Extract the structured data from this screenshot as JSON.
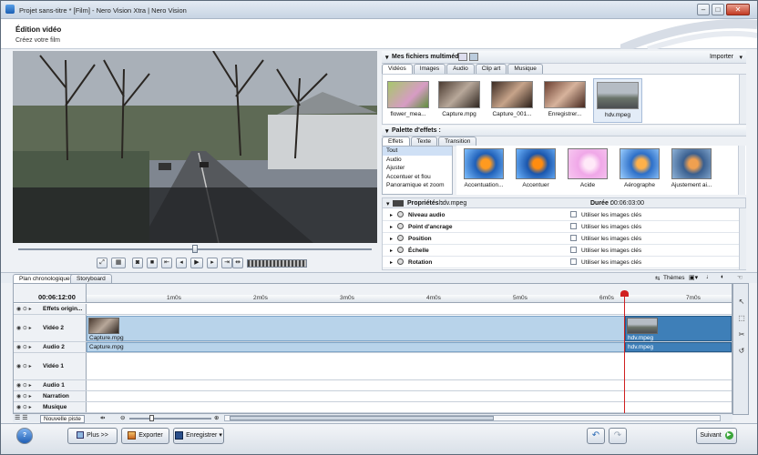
{
  "window": {
    "title": "Projet sans-titre * [Film] - Nero Vision Xtra | Nero Vision",
    "min": "–",
    "max": "□",
    "close": "✕"
  },
  "header": {
    "title": "Édition vidéo",
    "subtitle": "Créez votre film"
  },
  "media_panel": {
    "title": "Mes fichiers multimédias",
    "import_label": "Importer",
    "tabs": [
      "Vidéos",
      "Images",
      "Audio",
      "Clip art",
      "Musique"
    ],
    "items": [
      "flower_mea...",
      "Capture.mpg",
      "Capture_001...",
      "Enregistrer...",
      "hdv.mpeg"
    ]
  },
  "effects_panel": {
    "title": "Palette d'effets :",
    "tabs": [
      "Effets",
      "Texte",
      "Transition"
    ],
    "categories": [
      "Tout",
      "Audio",
      "Ajuster",
      "Accentuer et flou",
      "Panoramique et zoom"
    ],
    "effects": [
      "Accentuation...",
      "Accentuer",
      "Acide",
      "Aérographe",
      "Ajustement ai..."
    ]
  },
  "properties": {
    "title": "Propriétés :",
    "file": "hdv.mpeg",
    "duration_label": "Durée :",
    "duration": "00:06:03:00",
    "rows": [
      "Niveau audio",
      "Point d'ancrage",
      "Position",
      "Échelle",
      "Rotation"
    ],
    "checkbox_label": "Utiliser les images clés"
  },
  "timeline": {
    "tabs": [
      "Plan chronologique",
      "Storyboard"
    ],
    "themes_label": "Thèmes",
    "timecode": "00:06:12:00",
    "ruler": [
      "1m0s",
      "2m0s",
      "3m0s",
      "4m0s",
      "5m0s",
      "6m0s",
      "7m0s"
    ],
    "tracks": [
      "Effets origin...",
      "Vidéo 2",
      "Audio 2",
      "Vidéo 1",
      "Audio 1",
      "Narration",
      "Musique"
    ],
    "clips": {
      "video2_a": "Capture.mpg",
      "audio2_a": "Capture.mpg",
      "video2_b": "hdv.mpeg",
      "audio2_b": "hdv.mpeg"
    },
    "new_track_label": "Nouvelle piste"
  },
  "bottom": {
    "help": "?",
    "more": "Plus >>",
    "export": "Exporter",
    "save": "Enregistrer",
    "next": "Suivant"
  }
}
